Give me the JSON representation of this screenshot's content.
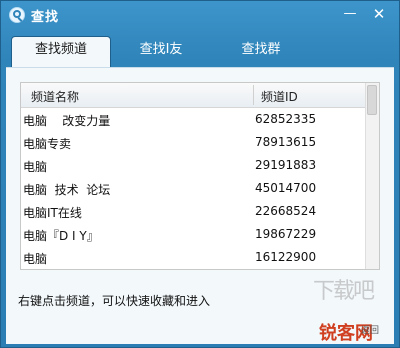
{
  "window": {
    "title": "查找",
    "minimize_glyph": "—",
    "close_glyph": "✕"
  },
  "tabs": [
    {
      "label": "查找频道",
      "active": true
    },
    {
      "label": "查找I友",
      "active": false
    },
    {
      "label": "查找群",
      "active": false
    }
  ],
  "table": {
    "columns": [
      "频道名称",
      "频道ID"
    ],
    "rows": [
      {
        "name": "电脑    改变力量",
        "id": "62852335"
      },
      {
        "name": "电脑专卖",
        "id": "78913615"
      },
      {
        "name": "电脑",
        "id": "29191883"
      },
      {
        "name": "电脑  技术  论坛",
        "id": "45014700"
      },
      {
        "name": "电脑IT在线",
        "id": "22668524"
      },
      {
        "name": "电脑『D I Y』",
        "id": "19867229"
      },
      {
        "name": "电脑",
        "id": "16122900"
      }
    ]
  },
  "hint": "右键点击频道，可以快速收藏和进入",
  "watermark": {
    "primary": "下载吧",
    "secondary": "锐客网",
    "tiny": "返回"
  },
  "colors": {
    "titlebar": "#3d95cb",
    "panel": "#f3f8fb",
    "border": "#1f5f8b"
  }
}
